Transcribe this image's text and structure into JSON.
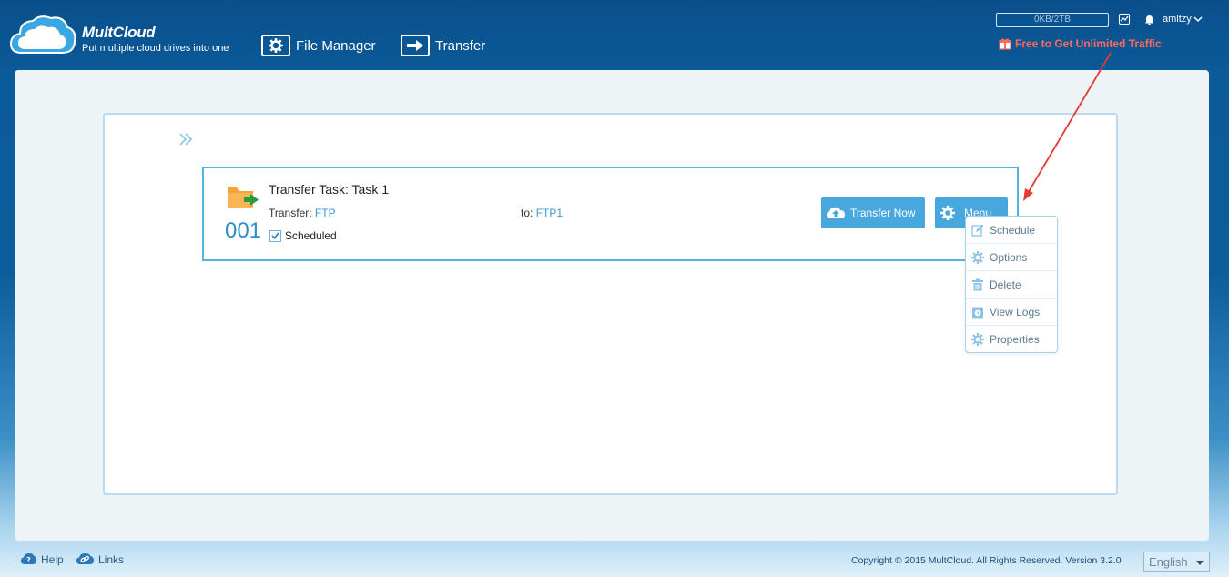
{
  "header": {
    "brand": "MultCloud",
    "tagline": "Put multiple cloud drives into one",
    "nav": [
      {
        "label": "File Manager",
        "icon": "gear-icon"
      },
      {
        "label": "Transfer",
        "icon": "transfer-arrow-icon"
      }
    ],
    "storage": "0KB/2TB",
    "username": "amltzy",
    "promo": "Free to Get Unlimited Traffic"
  },
  "task": {
    "title": "Transfer Task: Task 1",
    "number": "001",
    "transfer_label": "Transfer:",
    "transfer_source": "FTP",
    "to_label": "to:",
    "to_target": "FTP1",
    "scheduled_label": "Scheduled",
    "transfer_now_label": "Transfer Now",
    "menu_label": "Menu"
  },
  "menu": {
    "items": [
      {
        "label": "Schedule",
        "icon": "edit-icon"
      },
      {
        "label": "Options",
        "icon": "gear-icon"
      },
      {
        "label": "Delete",
        "icon": "trash-icon"
      },
      {
        "label": "View Logs",
        "icon": "log-icon"
      },
      {
        "label": "Properties",
        "icon": "gear-icon"
      }
    ]
  },
  "footer": {
    "help": "Help",
    "links": "Links",
    "copyright": "Copyright © 2015 MultCloud. All Rights Reserved. Version 3.2.0",
    "language": "English"
  },
  "colors": {
    "header_bg": "#0b5a99",
    "accent": "#48a8de",
    "promo": "#ff6a5a",
    "annotation_arrow": "#e53935"
  }
}
